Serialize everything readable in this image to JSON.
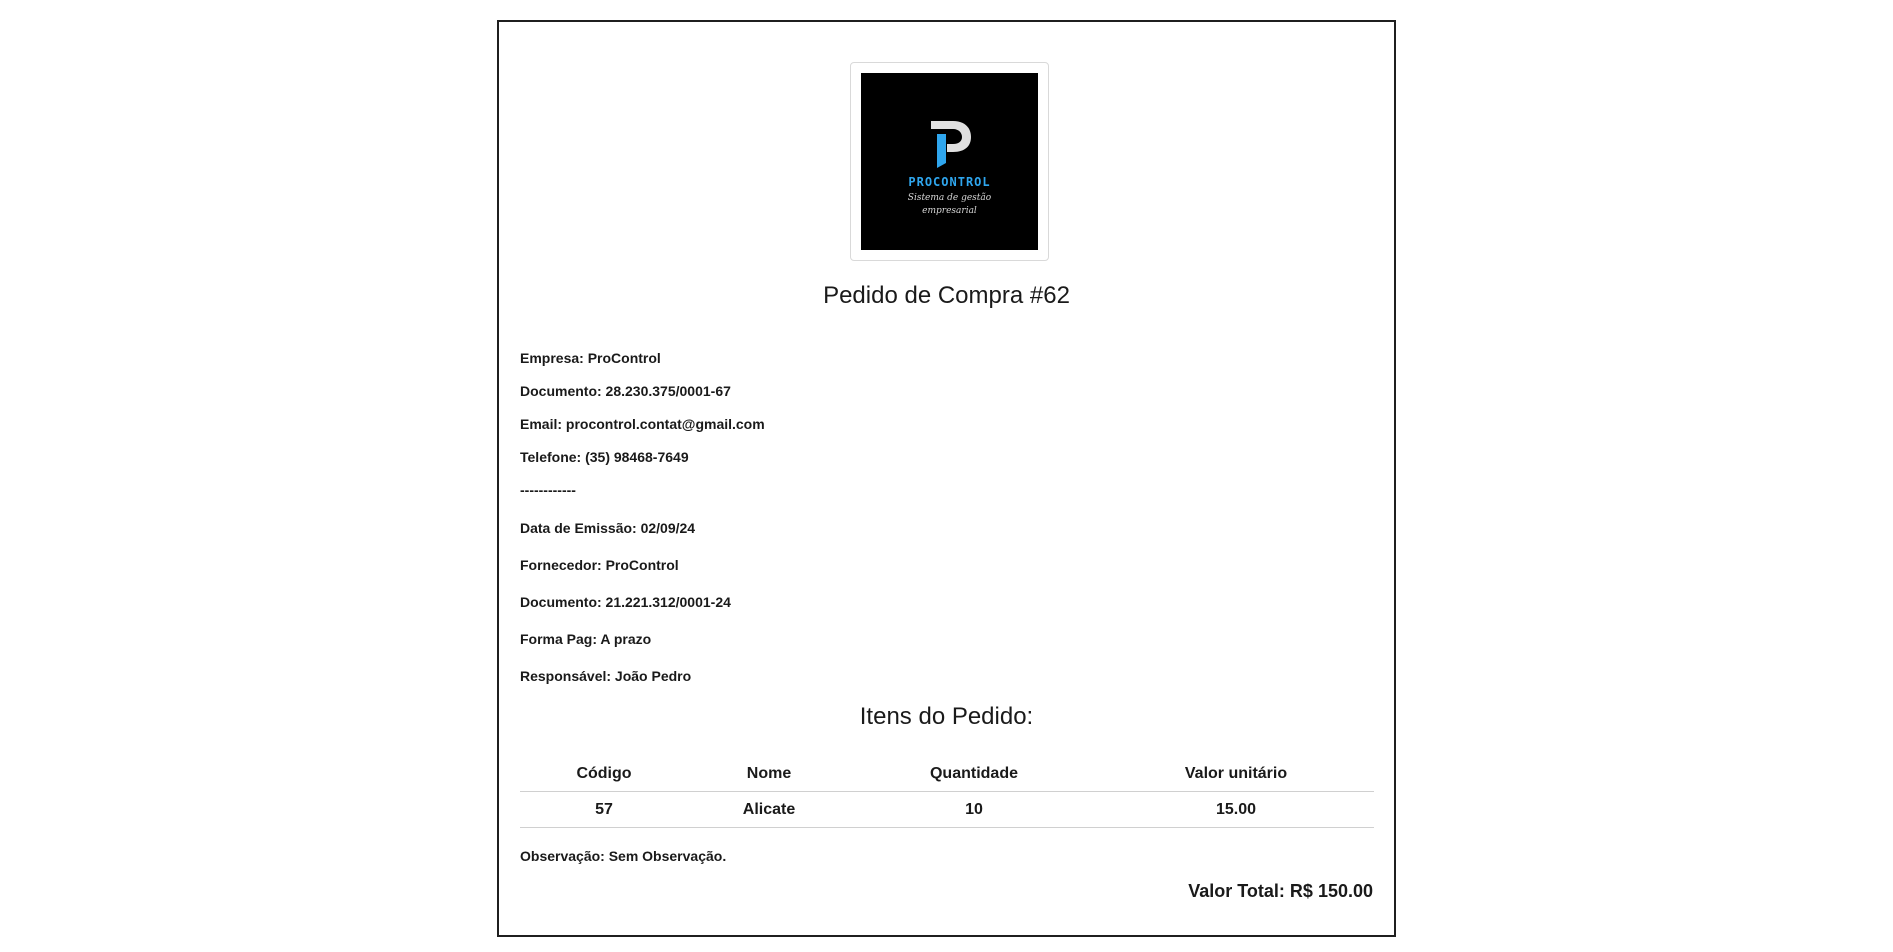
{
  "document": {
    "title": "Pedido de Compra #62",
    "logo": {
      "brand": "PROCONTROL",
      "tagline": "Sistema de gestão empresarial",
      "mark_icon": "procontrol-p-logo",
      "colors": {
        "background": "#000000",
        "brand_blue": "#2fa6ee",
        "mark_gray": "#e0e0e0"
      }
    },
    "company": [
      "Empresa: ProControl",
      "Documento: 28.230.375/0001-67",
      "Email: procontrol.contat@gmail.com",
      "Telefone: (35) 98468-7649"
    ],
    "separator": "------------",
    "order": [
      "Data de Emissão: 02/09/24",
      "Fornecedor: ProControl",
      "Documento: 21.221.312/0001-24",
      "Forma Pag: A prazo",
      "Responsável: João Pedro"
    ],
    "items_heading": "Itens do Pedido:",
    "items_table": {
      "headers": [
        "Código",
        "Nome",
        "Quantidade",
        "Valor unitário"
      ],
      "rows": [
        [
          "57",
          "Alicate",
          "10",
          "15.00"
        ]
      ]
    },
    "observation": "Observação: Sem Observação.",
    "total": "Valor Total: R$ 150.00"
  }
}
